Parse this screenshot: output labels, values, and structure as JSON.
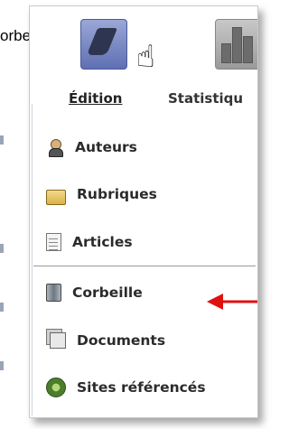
{
  "caption_fragment": "orbeille.",
  "tabs": [
    {
      "label": "Édition",
      "active": true,
      "icon": "pencil-icon"
    },
    {
      "label": "Statistiqu",
      "active": false,
      "icon": "bar-chart-icon"
    }
  ],
  "menu_items": [
    {
      "label": "Auteurs",
      "icon": "user-icon"
    },
    {
      "label": "Rubriques",
      "icon": "folder-icon"
    },
    {
      "label": "Articles",
      "icon": "document-icon"
    },
    {
      "label": "Corbeille",
      "icon": "trash-icon",
      "highlighted": true
    },
    {
      "label": "Documents",
      "icon": "documents-icon"
    },
    {
      "label": "Sites référencés",
      "icon": "sites-icon"
    }
  ],
  "annotation": {
    "arrow_color": "#e01010"
  }
}
